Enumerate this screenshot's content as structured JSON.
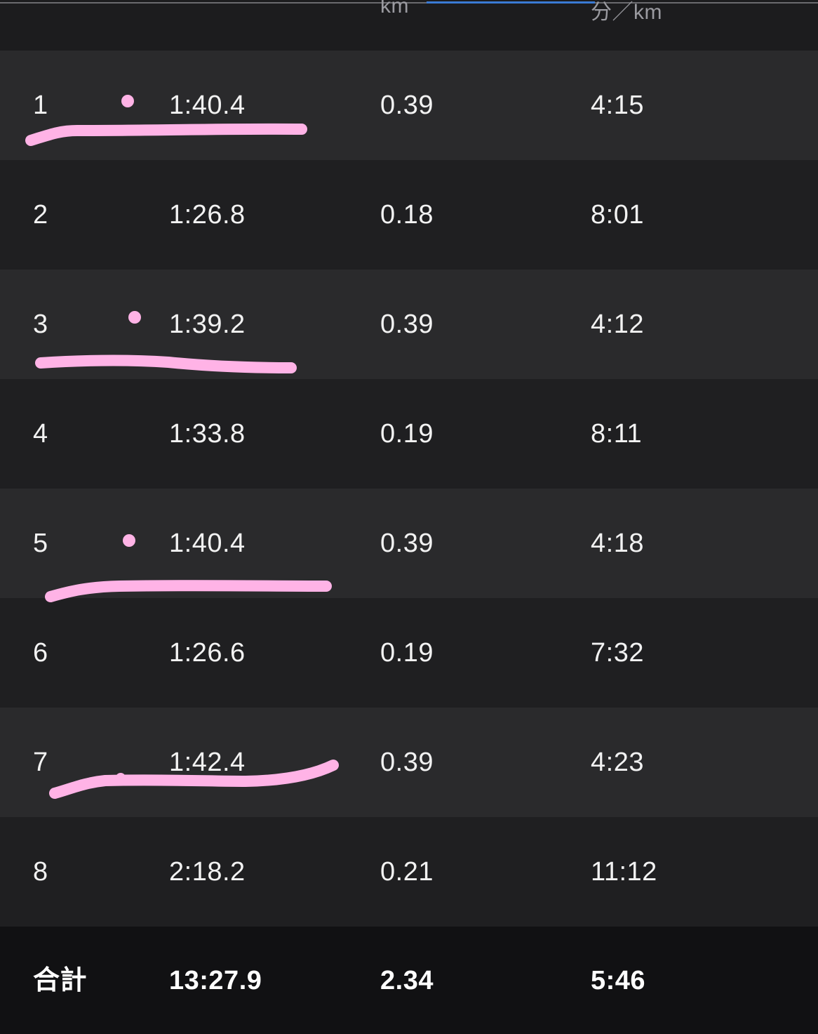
{
  "header": {
    "dist_unit": "km",
    "pace_unit": "分／km"
  },
  "laps": [
    {
      "lap": "1",
      "time": "1:40.4",
      "distance": "0.39",
      "pace": "4:15"
    },
    {
      "lap": "2",
      "time": "1:26.8",
      "distance": "0.18",
      "pace": "8:01"
    },
    {
      "lap": "3",
      "time": "1:39.2",
      "distance": "0.39",
      "pace": "4:12"
    },
    {
      "lap": "4",
      "time": "1:33.8",
      "distance": "0.19",
      "pace": "8:11"
    },
    {
      "lap": "5",
      "time": "1:40.4",
      "distance": "0.39",
      "pace": "4:18"
    },
    {
      "lap": "6",
      "time": "1:26.6",
      "distance": "0.19",
      "pace": "7:32"
    },
    {
      "lap": "7",
      "time": "1:42.4",
      "distance": "0.39",
      "pace": "4:23"
    },
    {
      "lap": "8",
      "time": "2:18.2",
      "distance": "0.21",
      "pace": "11:12"
    }
  ],
  "total": {
    "label": "合計",
    "time": "13:27.9",
    "distance": "2.34",
    "pace": "5:46"
  },
  "colors": {
    "highlight": "#ffb3e6",
    "accent": "#3a7bd5"
  }
}
